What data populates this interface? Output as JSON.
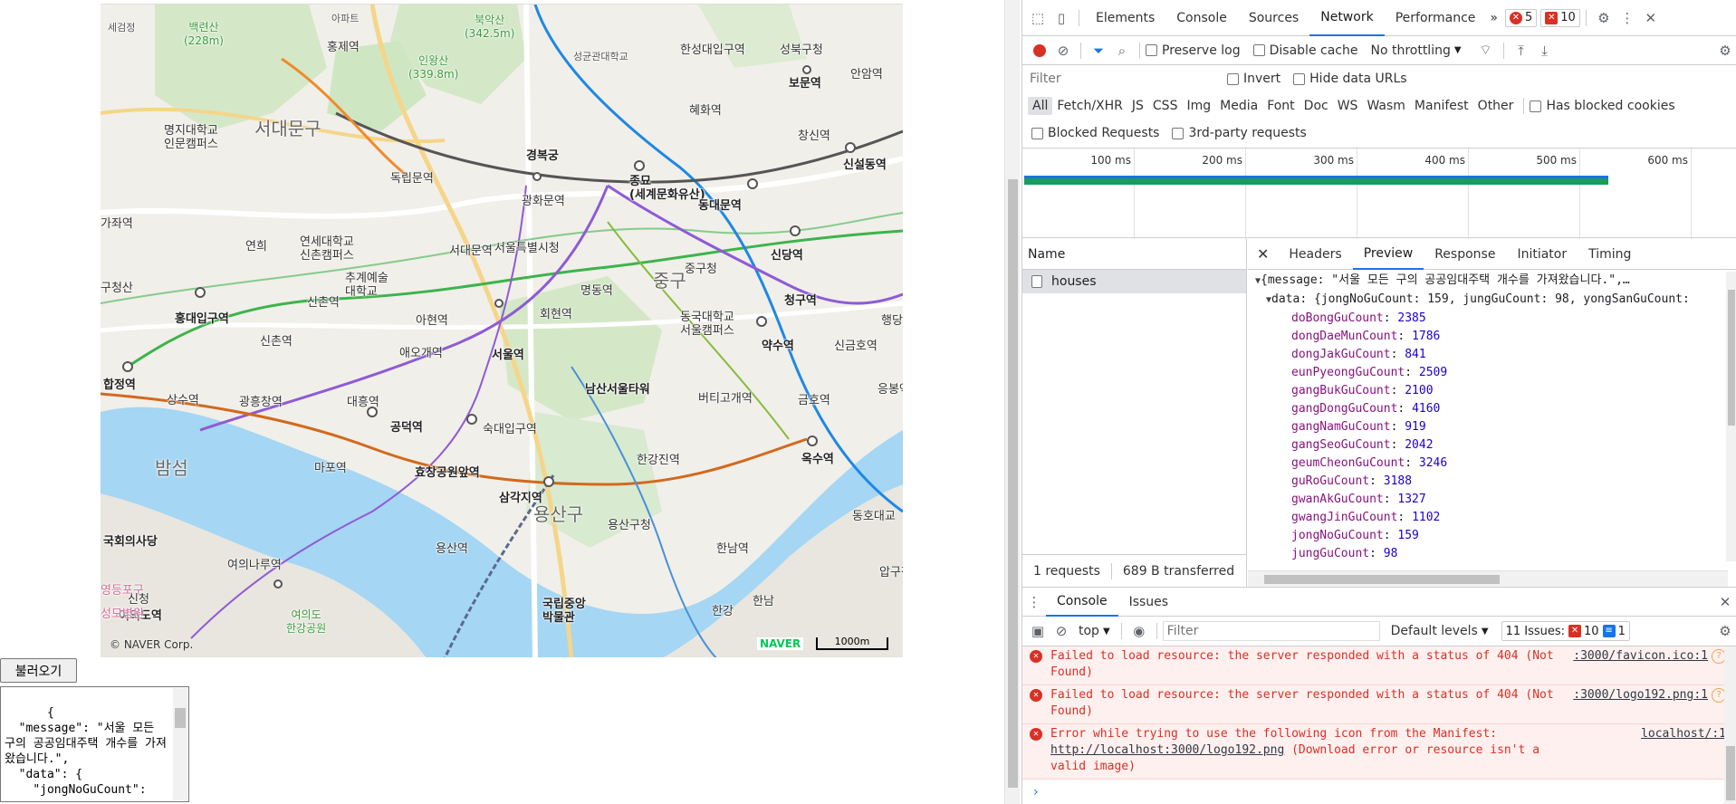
{
  "map": {
    "labels": [
      {
        "text": "세검정",
        "cls": "small"
      },
      {
        "text": "백련산\n(228m)",
        "cls": "green"
      },
      {
        "text": "아파트",
        "cls": "small"
      },
      {
        "text": "북악산\n(342.5m)",
        "cls": "green"
      },
      {
        "text": "홍제역",
        "cls": ""
      },
      {
        "text": "인왕산\n(339.8m)",
        "cls": "green"
      },
      {
        "text": "성균관대학교",
        "cls": "small"
      },
      {
        "text": "한성대입구역",
        "cls": ""
      },
      {
        "text": "성북구청",
        "cls": ""
      },
      {
        "text": "보문역",
        "cls": "bold"
      },
      {
        "text": "안암역",
        "cls": ""
      },
      {
        "text": "서대문구",
        "cls": "big"
      },
      {
        "text": "명지대학교\n인문캠퍼스",
        "cls": ""
      },
      {
        "text": "혜화역",
        "cls": ""
      },
      {
        "text": "경복궁",
        "cls": "bold"
      },
      {
        "text": "창신역",
        "cls": ""
      },
      {
        "text": "독립문역",
        "cls": ""
      },
      {
        "text": "종묘\n(세계문화유산)",
        "cls": "bold"
      },
      {
        "text": "신설동역",
        "cls": "bold"
      },
      {
        "text": "가좌역",
        "cls": ""
      },
      {
        "text": "광화문역",
        "cls": ""
      },
      {
        "text": "동대문역",
        "cls": "bold"
      },
      {
        "text": "연희",
        "cls": ""
      },
      {
        "text": "연세대학교\n신촌캠퍼스",
        "cls": ""
      },
      {
        "text": "서대문역",
        "cls": ""
      },
      {
        "text": "서울특별시청",
        "cls": ""
      },
      {
        "text": "신당역",
        "cls": "bold"
      },
      {
        "text": "추계예술\n대학교",
        "cls": ""
      },
      {
        "text": "중구청",
        "cls": ""
      },
      {
        "text": "중구",
        "cls": "big"
      },
      {
        "text": "구청산",
        "cls": ""
      },
      {
        "text": "신촌역",
        "cls": ""
      },
      {
        "text": "명동역",
        "cls": ""
      },
      {
        "text": "청구역",
        "cls": "bold"
      },
      {
        "text": "홍대입구역",
        "cls": "bold"
      },
      {
        "text": "회현역",
        "cls": ""
      },
      {
        "text": "동국대학교\n서울캠퍼스",
        "cls": ""
      },
      {
        "text": "행당역",
        "cls": ""
      },
      {
        "text": "신촌역",
        "cls": ""
      },
      {
        "text": "아현역",
        "cls": ""
      },
      {
        "text": "약수역",
        "cls": "bold"
      },
      {
        "text": "신금호역",
        "cls": ""
      },
      {
        "text": "애오개역",
        "cls": ""
      },
      {
        "text": "서울역",
        "cls": "bold"
      },
      {
        "text": "합정역",
        "cls": "bold"
      },
      {
        "text": "남산서울타워",
        "cls": "bold"
      },
      {
        "text": "응봉역",
        "cls": ""
      },
      {
        "text": "상수역",
        "cls": ""
      },
      {
        "text": "광흥창역",
        "cls": ""
      },
      {
        "text": "대흥역",
        "cls": ""
      },
      {
        "text": "버티고개역",
        "cls": ""
      },
      {
        "text": "금호역",
        "cls": ""
      },
      {
        "text": "공덕역",
        "cls": "bold"
      },
      {
        "text": "숙대입구역",
        "cls": ""
      },
      {
        "text": "밤섬",
        "cls": "big"
      },
      {
        "text": "마포역",
        "cls": ""
      },
      {
        "text": "효창공원앞역",
        "cls": "bold"
      },
      {
        "text": "한강진역",
        "cls": ""
      },
      {
        "text": "옥수역",
        "cls": "bold"
      },
      {
        "text": "삼각지역",
        "cls": "bold"
      },
      {
        "text": "용산구",
        "cls": "big"
      },
      {
        "text": "용산구청",
        "cls": ""
      },
      {
        "text": "동호대교",
        "cls": ""
      },
      {
        "text": "국회의사당",
        "cls": "bold"
      },
      {
        "text": "용산역",
        "cls": ""
      },
      {
        "text": "한남역",
        "cls": ""
      },
      {
        "text": "여의나루역",
        "cls": ""
      },
      {
        "text": "압구정역",
        "cls": ""
      },
      {
        "text": "국립중앙\n박물관",
        "cls": "bold"
      },
      {
        "text": "한남",
        "cls": ""
      },
      {
        "text": "여의도역",
        "cls": "bold"
      },
      {
        "text": "여의도\n한강공원",
        "cls": "green"
      },
      {
        "text": "한강",
        "cls": ""
      },
      {
        "text": "영등포구",
        "cls": "pink"
      },
      {
        "text": "신청",
        "cls": ""
      },
      {
        "text": "성모병원",
        "cls": "pink"
      }
    ],
    "copyright": "© NAVER Corp.",
    "brand": "NAVER",
    "scale": "1000m"
  },
  "page": {
    "load_button": "불러오기",
    "result_text": "{\n  \"message\": \"서울 모든 구의 공공임대주택 개수를 가져왔습니다.\",\n  \"data\": {\n    \"jongNoGuCount\":"
  },
  "devtools": {
    "tabs": [
      "Elements",
      "Console",
      "Sources",
      "Network",
      "Performance"
    ],
    "more": "»",
    "error_count": "5",
    "warning_count": "10",
    "network_toolbar": {
      "preserve_log": "Preserve log",
      "disable_cache": "Disable cache",
      "throttling": "No throttling"
    },
    "filter": {
      "placeholder": "Filter",
      "invert": "Invert",
      "hide_data_urls": "Hide data URLs"
    },
    "types": [
      "All",
      "Fetch/XHR",
      "JS",
      "CSS",
      "Img",
      "Media",
      "Font",
      "Doc",
      "WS",
      "Wasm",
      "Manifest",
      "Other"
    ],
    "has_blocked_cookies": "Has blocked cookies",
    "blocked_requests": "Blocked Requests",
    "third_party": "3rd-party requests",
    "timeline_ticks": [
      "100 ms",
      "200 ms",
      "300 ms",
      "400 ms",
      "500 ms",
      "600 ms"
    ],
    "name_header": "Name",
    "request_name": "houses",
    "footer": {
      "requests": "1 requests",
      "transferred": "689 B transferred"
    },
    "detail_tabs": [
      "Headers",
      "Preview",
      "Response",
      "Initiator",
      "Timing"
    ],
    "preview": {
      "line1": "{message: \"서울 모든 구의 공공임대주택 개수를 가져왔습니다.\",…",
      "line2": "data: {jongNoGuCount: 159, jungGuCount: 98, yongSanGuCount:",
      "entries": [
        {
          "k": "doBongGuCount",
          "v": "2385"
        },
        {
          "k": "dongDaeMunCount",
          "v": "1786"
        },
        {
          "k": "dongJakGuCount",
          "v": "841"
        },
        {
          "k": "eunPyeongGuCount",
          "v": "2509"
        },
        {
          "k": "gangBukGuCount",
          "v": "2100"
        },
        {
          "k": "gangDongGuCount",
          "v": "4160"
        },
        {
          "k": "gangNamGuCount",
          "v": "919"
        },
        {
          "k": "gangSeoGuCount",
          "v": "2042"
        },
        {
          "k": "geumCheonGuCount",
          "v": "3246"
        },
        {
          "k": "guRoGuCount",
          "v": "3188"
        },
        {
          "k": "gwanAkGuCount",
          "v": "1327"
        },
        {
          "k": "gwangJinGuCount",
          "v": "1102"
        },
        {
          "k": "jongNoGuCount",
          "v": "159"
        },
        {
          "k": "jungGuCount",
          "v": "98"
        }
      ]
    },
    "console": {
      "tabs": [
        "Console",
        "Issues"
      ],
      "context": "top",
      "filter_placeholder": "Filter",
      "levels": "Default levels",
      "issues_label": "11 Issues:",
      "issues_errors": "10",
      "issues_info": "1",
      "messages": [
        {
          "text": "Failed to load resource: the server responded with a status of 404 (Not Found)",
          "loc": ":3000/favicon.ico:1"
        },
        {
          "text": "Failed to load resource: the server responded with a status of 404 (Not Found)",
          "loc": ":3000/logo192.png:1"
        },
        {
          "text": "Error while trying to use the following icon from the Manifest: ",
          "link": "http://localhost:3000/logo192.png",
          "rest": " (Download error or resource isn't a valid image)",
          "loc": "localhost/:1"
        }
      ]
    }
  }
}
